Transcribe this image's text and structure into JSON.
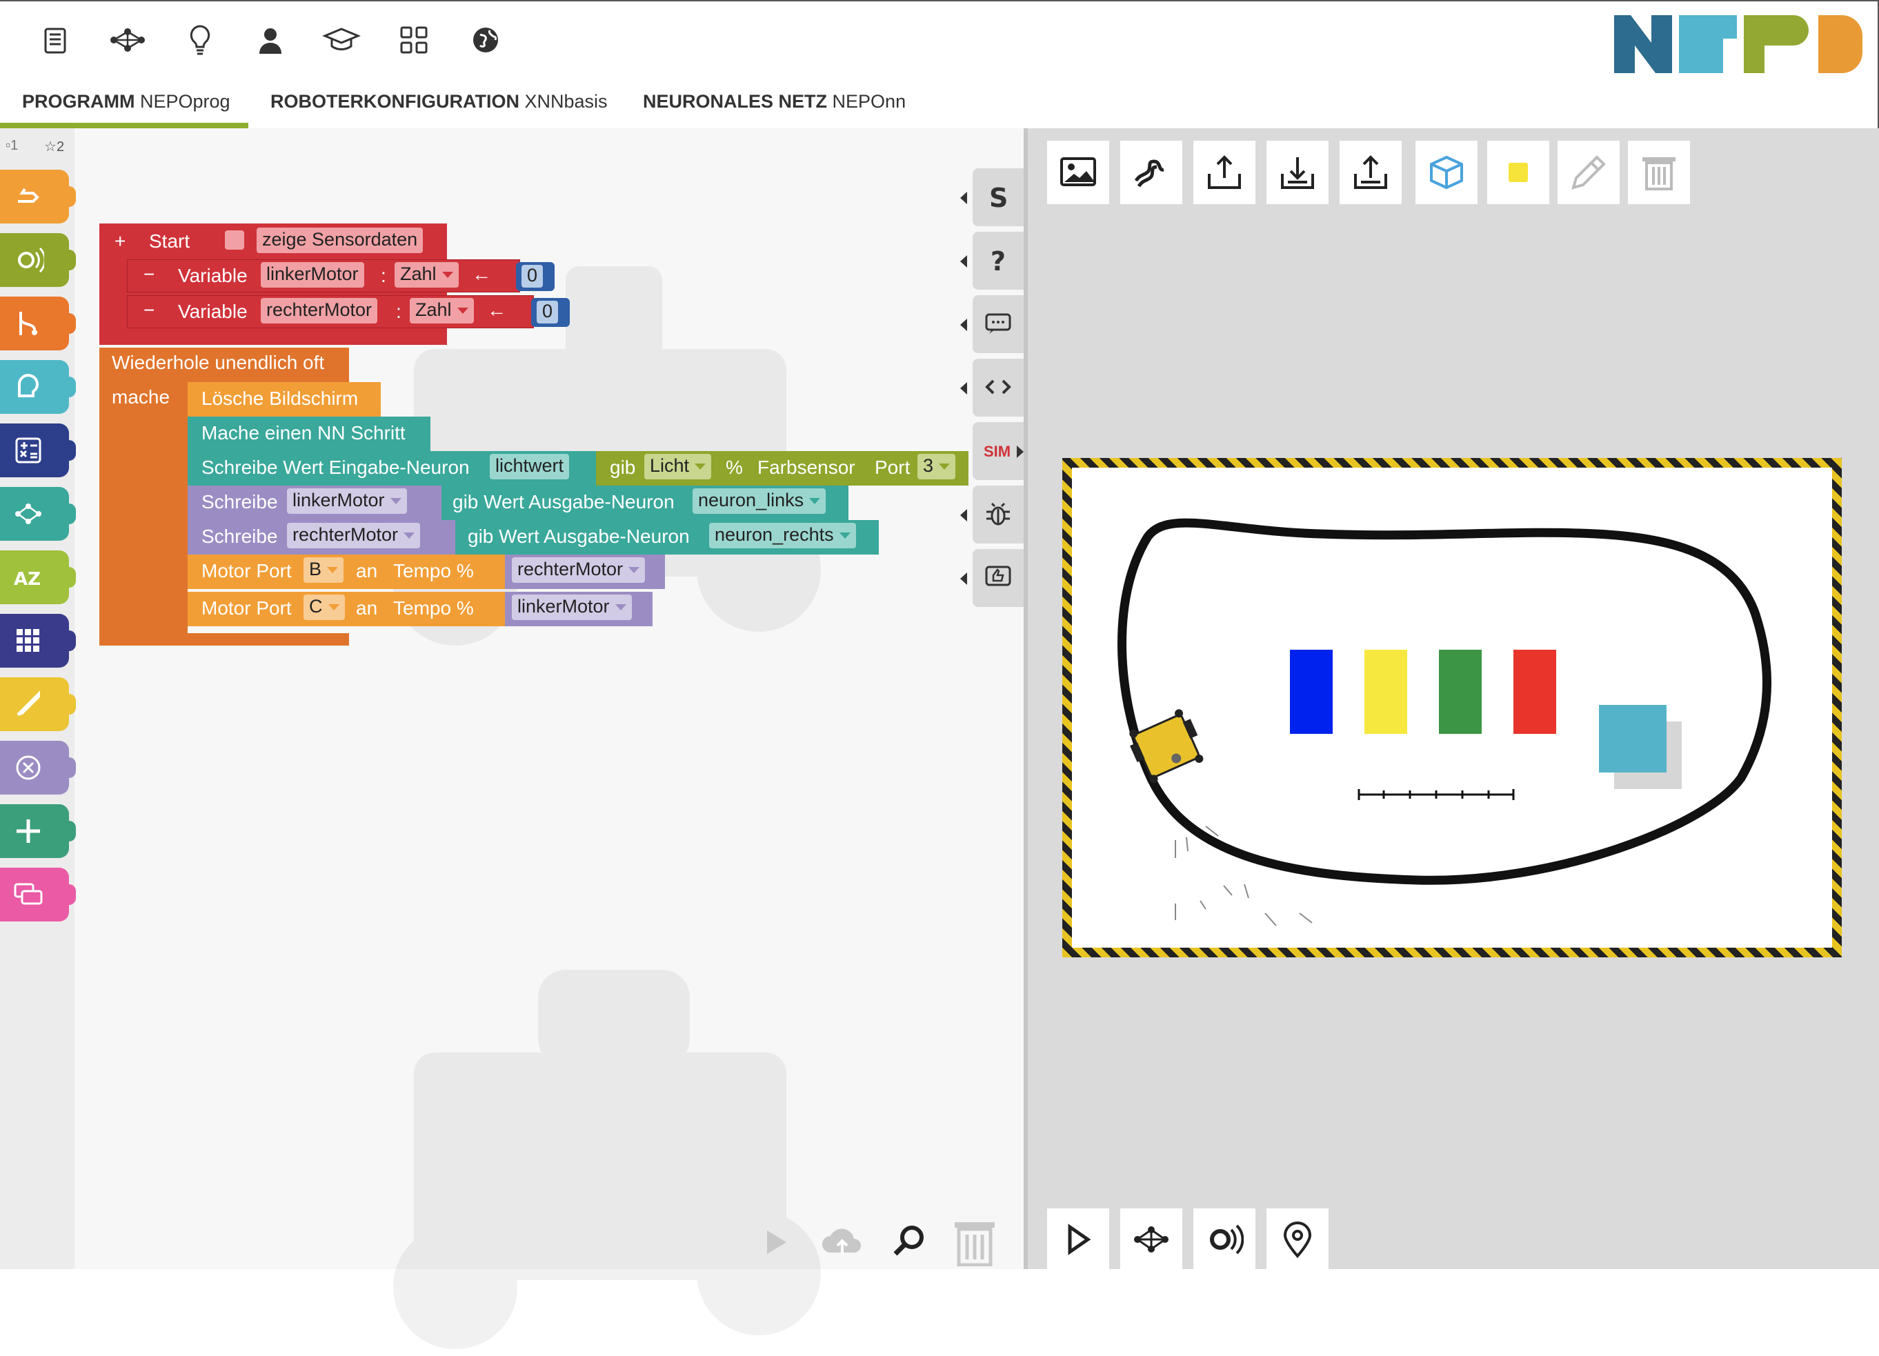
{
  "header": {
    "tabs": [
      {
        "name": "PROGRAMM",
        "sub": "NEPOprog"
      },
      {
        "name": "ROBOTERKONFIGURATION",
        "sub": "XNNbasis"
      },
      {
        "name": "NEURONALES NETZ",
        "sub": "NEPOnn"
      }
    ],
    "menu_icons": [
      "edit-icon",
      "network-icon",
      "lightbulb-icon",
      "user-icon",
      "graduation-cap-icon",
      "gallery-grid-icon",
      "globe-icon"
    ]
  },
  "toolbox": {
    "levels": [
      "1",
      "2"
    ],
    "categories": [
      {
        "icon": "action-icon",
        "color": "#f29e36"
      },
      {
        "icon": "sensor-icon",
        "color": "#8fa52b"
      },
      {
        "icon": "control-icon",
        "color": "#e9772c"
      },
      {
        "icon": "logic-icon",
        "color": "#4fb8c7"
      },
      {
        "icon": "math-icon",
        "color": "#2d3e8b"
      },
      {
        "icon": "neural-network-icon",
        "color": "#3aa89b"
      },
      {
        "icon": "text-icon",
        "color": "#9fc13b"
      },
      {
        "icon": "lists-icon",
        "color": "#3b3b8c"
      },
      {
        "icon": "colour-icon",
        "color": "#ecc434"
      },
      {
        "icon": "variables-icon",
        "color": "#9b8dc3"
      },
      {
        "icon": "functions-icon",
        "color": "#3c9f7c"
      },
      {
        "icon": "messages-icon",
        "color": "#ea5aa5"
      }
    ]
  },
  "program": {
    "start": {
      "label": "Start",
      "sensor_label": "zeige Sensordaten"
    },
    "vars": [
      {
        "kw": "Variable",
        "name": "linkerMotor",
        "colon": ":",
        "type": "Zahl",
        "arrow": "←",
        "value": "0"
      },
      {
        "kw": "Variable",
        "name": "rechterMotor",
        "colon": ":",
        "type": "Zahl",
        "arrow": "←",
        "value": "0"
      }
    ],
    "loop": {
      "label": "Wiederhole unendlich oft",
      "do": "mache"
    },
    "stmts": {
      "clear": "Lösche Bildschirm",
      "nn_step": "Mache einen NN Schritt",
      "write_input": "Schreibe Wert Eingabe-Neuron",
      "input_neuron": "lichtwert",
      "gib": "gib",
      "light": "Licht",
      "percent": "%",
      "sensor": "Farbsensor",
      "port_label": "Port",
      "port": "3",
      "write": "Schreibe",
      "left_var": "linkerMotor",
      "right_var": "rechterMotor",
      "get_output": "gib Wert Ausgabe-Neuron",
      "out_left": "neuron_links",
      "out_right": "neuron_rechts",
      "motor_port": "Motor Port",
      "port_b": "B",
      "port_c": "C",
      "an": "an",
      "tempo": "Tempo %",
      "motor_b_var": "rechterMotor",
      "motor_c_var": "linkerMotor"
    }
  },
  "sidebar_right": {
    "sim_label": "SIM",
    "buttons": [
      "robot-config-icon",
      "help-icon",
      "info-icon",
      "code-icon",
      "sim-button",
      "debug-icon",
      "feedback-icon"
    ]
  },
  "sim_toolbar": [
    "background-image-icon",
    "trail-icon",
    "upload-icon",
    "import-icon",
    "export-icon",
    "3d-cube-icon",
    "colour-square-icon",
    "pipette-icon",
    "trash-icon"
  ],
  "sim_controls": [
    "play-icon",
    "network-icon",
    "sensor-icon",
    "location-icon"
  ],
  "scene": {
    "color_bars": [
      "#0022ee",
      "#f7e840",
      "#3c9545",
      "#e8342b"
    ],
    "obstacle_color": "#55b3c9",
    "robot_color": "#e9c22b"
  }
}
